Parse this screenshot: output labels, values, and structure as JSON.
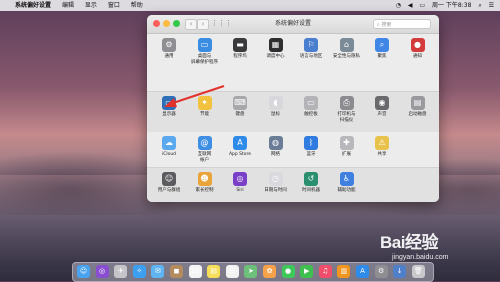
{
  "menubar": {
    "apple": "",
    "app": "系统偏好设置",
    "menus": [
      "编辑",
      "显示",
      "窗口",
      "帮助"
    ],
    "clock": "周一 下午8:38",
    "status_icons": [
      "wifi-icon",
      "volume-icon",
      "battery-icon",
      "search-icon",
      "list-icon"
    ]
  },
  "window": {
    "title": "系统偏好设置",
    "search_placeholder": "搜索",
    "back": "‹",
    "forward": "›",
    "grid": "⋮⋮⋮"
  },
  "rows": [
    [
      {
        "label": "通用",
        "icon": "general-icon",
        "color": "#8e8e93",
        "glyph": "⚙"
      },
      {
        "label": "桌面与\n屏幕保护程序",
        "icon": "desktop-icon",
        "color": "#3a8de0",
        "glyph": "▭"
      },
      {
        "label": "程序坞",
        "icon": "dock-icon",
        "color": "#3a3a3c",
        "glyph": "▬"
      },
      {
        "label": "调度中心",
        "icon": "mission-control-icon",
        "color": "#2e2e30",
        "glyph": "▦"
      },
      {
        "label": "语言与地区",
        "icon": "language-icon",
        "color": "#4a7fcf",
        "glyph": "⚐"
      },
      {
        "label": "安全性与隐私",
        "icon": "security-icon",
        "color": "#7a8a96",
        "glyph": "⌂"
      },
      {
        "label": "聚焦",
        "icon": "spotlight-icon",
        "color": "#3f86e6",
        "glyph": "⌕"
      },
      {
        "label": "通知",
        "icon": "notifications-icon",
        "color": "#d43c3c",
        "glyph": "●"
      }
    ],
    [
      {
        "label": "显示器",
        "icon": "displays-icon",
        "color": "#2f6fb8",
        "glyph": "▭"
      },
      {
        "label": "节能",
        "icon": "energy-icon",
        "color": "#f2c13d",
        "glyph": "✦"
      },
      {
        "label": "键盘",
        "icon": "keyboard-icon",
        "color": "#a8a8ac",
        "glyph": "⌨"
      },
      {
        "label": "鼠标",
        "icon": "mouse-icon",
        "color": "#d8d8dc",
        "glyph": "◖"
      },
      {
        "label": "触控板",
        "icon": "trackpad-icon",
        "color": "#b4b4b8",
        "glyph": "▭"
      },
      {
        "label": "打印机与\n扫描仪",
        "icon": "printer-icon",
        "color": "#8c8c90",
        "glyph": "⎙"
      },
      {
        "label": "声音",
        "icon": "sound-icon",
        "color": "#6a6a6e",
        "glyph": "◉"
      },
      {
        "label": "启动磁盘",
        "icon": "startup-disk-icon",
        "color": "#9a9a9e",
        "glyph": "▤"
      }
    ],
    [
      {
        "label": "iCloud",
        "icon": "icloud-icon",
        "color": "#5aa8ee",
        "glyph": "☁"
      },
      {
        "label": "互联网\n帐户",
        "icon": "internet-accounts-icon",
        "color": "#3e8ee4",
        "glyph": "@"
      },
      {
        "label": "App Store",
        "icon": "app-store-icon",
        "color": "#2f8bea",
        "glyph": "A"
      },
      {
        "label": "网络",
        "icon": "network-icon",
        "color": "#6b7d96",
        "glyph": "◍"
      },
      {
        "label": "蓝牙",
        "icon": "bluetooth-icon",
        "color": "#2f7be0",
        "glyph": "ᛒ"
      },
      {
        "label": "扩展",
        "icon": "extensions-icon",
        "color": "#b8b8bc",
        "glyph": "✚"
      },
      {
        "label": "共享",
        "icon": "sharing-icon",
        "color": "#e8c24a",
        "glyph": "⚠"
      }
    ],
    [
      {
        "label": "用户与群组",
        "icon": "users-icon",
        "color": "#5c5c60",
        "glyph": "☺"
      },
      {
        "label": "家长控制",
        "icon": "parental-controls-icon",
        "color": "#e9a43a",
        "glyph": "☻"
      },
      {
        "label": "Siri",
        "icon": "siri-icon",
        "color": "#7a3fc8",
        "glyph": "◎"
      },
      {
        "label": "日期与时间",
        "icon": "date-time-icon",
        "color": "#d9d9de",
        "glyph": "◷"
      },
      {
        "label": "时间机器",
        "icon": "time-machine-icon",
        "color": "#2a8f6e",
        "glyph": "↺"
      },
      {
        "label": "辅助功能",
        "icon": "accessibility-icon",
        "color": "#3e7fe0",
        "glyph": "♿"
      }
    ]
  ],
  "dock": [
    {
      "name": "finder-icon",
      "color": "#4aa3ef",
      "glyph": "☺"
    },
    {
      "name": "siri-icon",
      "color": "#8a4fd0",
      "glyph": "◎"
    },
    {
      "name": "launchpad-icon",
      "color": "#c5c5c9",
      "glyph": "✈"
    },
    {
      "name": "safari-icon",
      "color": "#3d9ff0",
      "glyph": "✧"
    },
    {
      "name": "mail-icon",
      "color": "#5fb4f2",
      "glyph": "✉"
    },
    {
      "name": "contacts-icon",
      "color": "#b38b5e",
      "glyph": "◼"
    },
    {
      "name": "calendar-icon",
      "color": "#f4f4f4",
      "glyph": "10"
    },
    {
      "name": "notes-icon",
      "color": "#f6dd5a",
      "glyph": "▤"
    },
    {
      "name": "reminders-icon",
      "color": "#f2f2f2",
      "glyph": "☰"
    },
    {
      "name": "maps-icon",
      "color": "#6cc07a",
      "glyph": "➤"
    },
    {
      "name": "photos-icon",
      "color": "#f5a24b",
      "glyph": "✿"
    },
    {
      "name": "messages-icon",
      "color": "#3fc85a",
      "glyph": "●"
    },
    {
      "name": "facetime-icon",
      "color": "#3fbf4f",
      "glyph": "▶"
    },
    {
      "name": "music-icon",
      "color": "#f04e6a",
      "glyph": "♫"
    },
    {
      "name": "books-icon",
      "color": "#f2951f",
      "glyph": "▥"
    },
    {
      "name": "app-store-icon",
      "color": "#2f8bea",
      "glyph": "A"
    },
    {
      "name": "system-preferences-icon",
      "color": "#8e8e93",
      "glyph": "⚙"
    },
    {
      "name": "downloads-icon",
      "color": "#4f7fc8",
      "glyph": "↓"
    },
    {
      "name": "trash-icon",
      "color": "#c8c8cc",
      "glyph": "🗑"
    }
  ],
  "watermark": {
    "logo": "Bai经验",
    "url": "jingyan.baidu.com"
  }
}
